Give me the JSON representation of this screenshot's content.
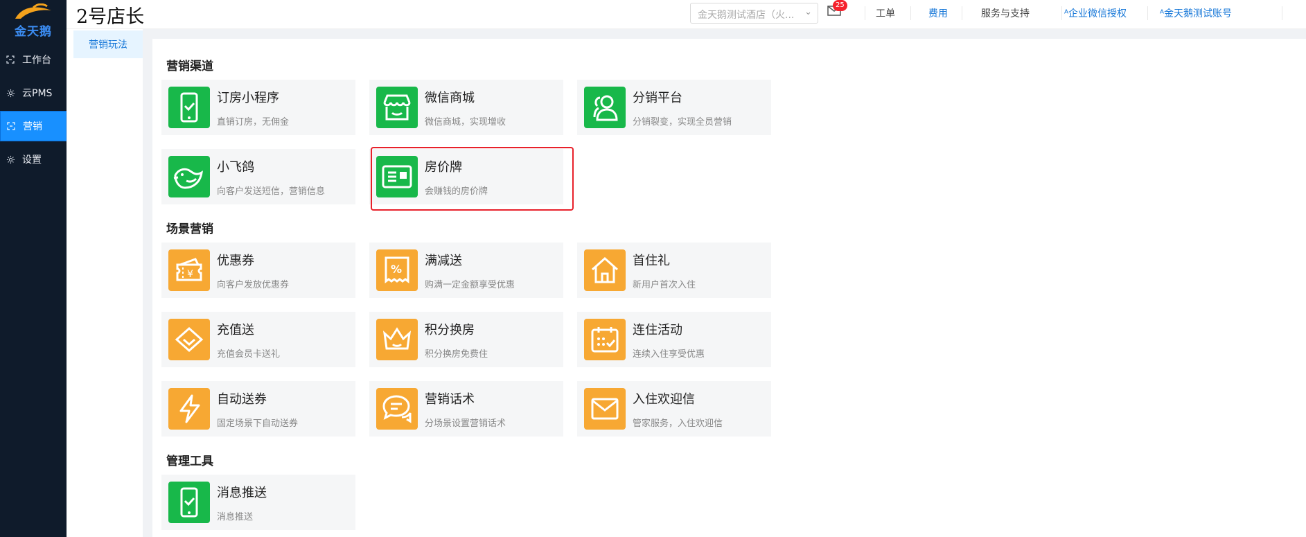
{
  "sidebar": {
    "logo_text": "金天鹅",
    "items": [
      {
        "label": "工作台",
        "icon": "workbench-icon",
        "active": false
      },
      {
        "label": "云PMS",
        "icon": "gear-icon",
        "active": false
      },
      {
        "label": "营销",
        "icon": "marketing-icon",
        "active": true
      },
      {
        "label": "设置",
        "icon": "gear-icon",
        "active": false
      }
    ]
  },
  "header": {
    "title": "2号店长",
    "store_select": "金天鹅测试酒店（火...",
    "mail_badge": "25",
    "links": [
      "工单",
      "费用",
      "服务与支持",
      "企业微信授权",
      "金天鹅测试账号"
    ]
  },
  "subnav": {
    "items": [
      "营销玩法"
    ]
  },
  "sections": [
    {
      "title": "营销渠道",
      "cards": [
        {
          "title": "订房小程序",
          "desc": "直销订房，无佣金",
          "icon": "phone-check-icon",
          "color": "green"
        },
        {
          "title": "微信商城",
          "desc": "微信商城，实现增收",
          "icon": "store-icon",
          "color": "green"
        },
        {
          "title": "分销平台",
          "desc": "分销裂变，实现全员营销",
          "icon": "users-icon",
          "color": "green"
        },
        {
          "title": "小飞鸽",
          "desc": "向客户发送短信，营销信息",
          "icon": "bird-icon",
          "color": "green"
        },
        {
          "title": "房价牌",
          "desc": "会赚钱的房价牌",
          "icon": "price-board-icon",
          "color": "green",
          "highlighted": true
        }
      ]
    },
    {
      "title": "场景营销",
      "cards": [
        {
          "title": "优惠券",
          "desc": "向客户发放优惠券",
          "icon": "coupon-icon",
          "color": "orange"
        },
        {
          "title": "满减送",
          "desc": "购满一定金额享受优惠",
          "icon": "percent-icon",
          "color": "orange"
        },
        {
          "title": "首住礼",
          "desc": "新用户首次入住",
          "icon": "house-icon",
          "color": "orange"
        },
        {
          "title": "充值送",
          "desc": "充值会员卡送礼",
          "icon": "diamond-icon",
          "color": "orange"
        },
        {
          "title": "积分换房",
          "desc": "积分换房免费住",
          "icon": "crown-icon",
          "color": "orange"
        },
        {
          "title": "连住活动",
          "desc": "连续入住享受优惠",
          "icon": "calendar-icon",
          "color": "orange"
        },
        {
          "title": "自动送券",
          "desc": "固定场景下自动送券",
          "icon": "lightning-icon",
          "color": "orange"
        },
        {
          "title": "营销话术",
          "desc": "分场景设置营销话术",
          "icon": "chat-icon",
          "color": "orange"
        },
        {
          "title": "入住欢迎信",
          "desc": "管家服务，入住欢迎信",
          "icon": "mail-icon",
          "color": "orange"
        }
      ]
    },
    {
      "title": "管理工具",
      "cards": [
        {
          "title": "消息推送",
          "desc": "消息推送",
          "icon": "phone-check-icon",
          "color": "green"
        }
      ]
    }
  ],
  "colors": {
    "green": "#18b84a",
    "orange": "#f7a833",
    "accent": "#1890ff",
    "highlight": "#e8202a"
  }
}
